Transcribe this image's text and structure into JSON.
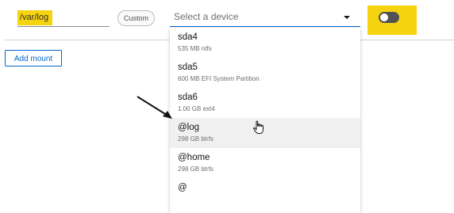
{
  "mount": {
    "path_value": "/var/log",
    "custom_badge": "Custom",
    "device_placeholder": "Select a device",
    "toggle_state": "off",
    "add_mount_label": "Add mount"
  },
  "dropdown": {
    "options": [
      {
        "name": "sda4",
        "detail": "535 MB ntfs"
      },
      {
        "name": "sda5",
        "detail": "600 MB EFI System Partition"
      },
      {
        "name": "sda6",
        "detail": "1.00 GB ext4"
      },
      {
        "name": "@log",
        "detail": "298 GB btrfs"
      },
      {
        "name": "@home",
        "detail": "298 GB btrfs"
      },
      {
        "name": "@",
        "detail": ""
      }
    ],
    "hovered_option": "@log"
  },
  "colors": {
    "highlight": "#f5d40f",
    "accent": "#0066cc",
    "hover_bg": "#f0f0f0"
  },
  "icons": [
    "caret-down-icon",
    "arrow-annotation-icon",
    "hand-pointer-icon"
  ]
}
